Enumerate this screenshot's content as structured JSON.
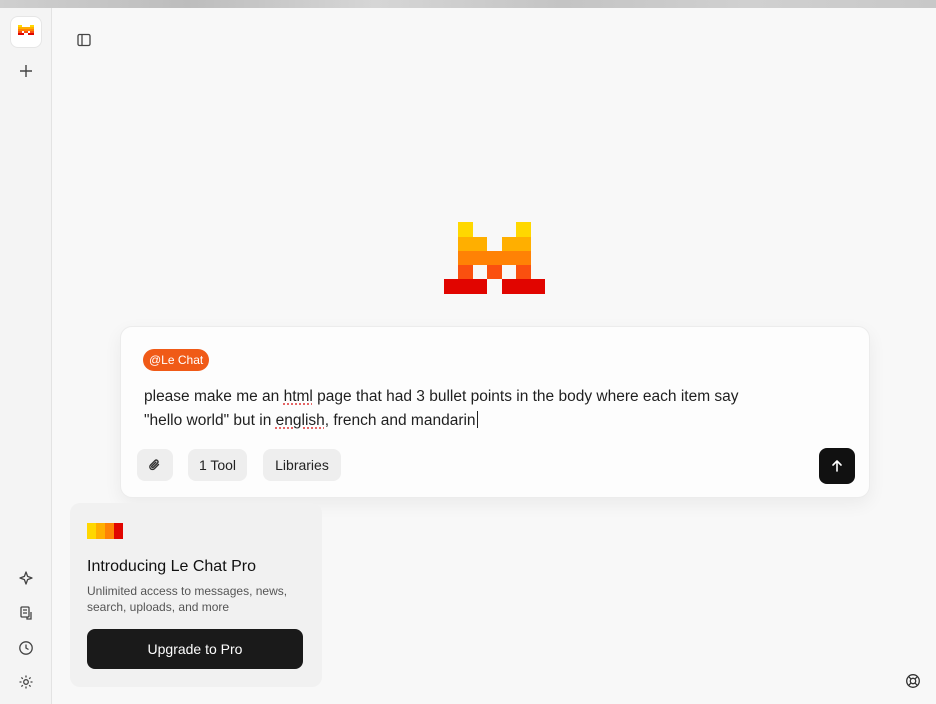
{
  "sidebar": {
    "logo_icon": "mistral-logo-icon",
    "new_chat_icon": "plus-icon",
    "bottom_icons": [
      "sparkle-agents-icon",
      "library-icon",
      "history-clock-icon",
      "gear-icon"
    ]
  },
  "header": {
    "panel_toggle_icon": "sidebar-panel-icon"
  },
  "composer": {
    "mention": "@Le Chat",
    "prompt_line1_a": "please make me an ",
    "prompt_html": "html",
    "prompt_line1_b": " page that had 3 bullet points in the body where each item say",
    "prompt_line2_a": "\"hello world\" but in ",
    "prompt_english": "english",
    "prompt_line2_b": ", french and mandarin",
    "attach_icon": "paperclip-icon",
    "tool_chip": "1 Tool",
    "libraries_chip": "Libraries",
    "send_icon": "arrow-up-icon"
  },
  "promo": {
    "title": "Introducing Le Chat Pro",
    "description": "Unlimited access to messages, news, search, uploads, and more",
    "button": "Upgrade to Pro",
    "colors": [
      "#ffd700",
      "#ffaf00",
      "#ff8205",
      "#e10500"
    ]
  },
  "help_icon": "help-lifebuoy-icon",
  "brand_colors": {
    "yellow": "#ffd800",
    "amber": "#ffaf00",
    "orange": "#ff8205",
    "dark_orange": "#fa500f",
    "red": "#e10500",
    "mention_bg": "#f05a17"
  }
}
